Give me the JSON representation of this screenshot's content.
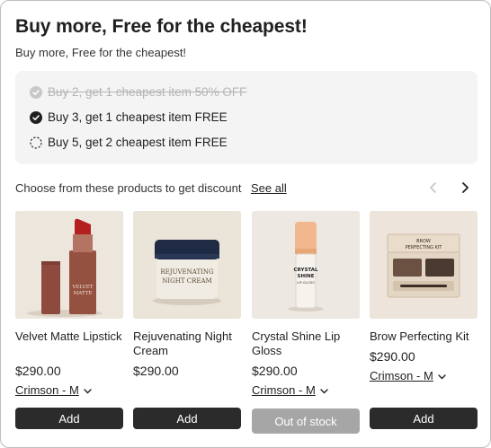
{
  "header": {
    "title": "Buy more, Free for the cheapest!",
    "subtitle": "Buy more, Free for the cheapest!"
  },
  "tiers": [
    {
      "label": "Buy 2, get 1 cheapest item 50% OFF",
      "state": "expired",
      "icon": "check-circle-icon"
    },
    {
      "label": "Buy 3, get 1 cheapest item FREE",
      "state": "achieved",
      "icon": "check-circle-icon"
    },
    {
      "label": "Buy 5, get 2 cheapest item FREE",
      "state": "pending",
      "icon": "dashed-circle-icon"
    }
  ],
  "products_section": {
    "label": "Choose from these products to get discount",
    "see_all": "See all"
  },
  "products": [
    {
      "name": "Velvet Matte Lipstick",
      "price": "$290.00",
      "variant": "Crimson - M",
      "button": "Add",
      "in_stock": true,
      "packaging_text": "VELVET MATTE"
    },
    {
      "name": "Rejuvenating Night Cream",
      "price": "$290.00",
      "variant": "",
      "button": "Add",
      "in_stock": true,
      "packaging_text": "REJUVENATING NIGHT CREAM"
    },
    {
      "name": "Crystal Shine Lip Gloss",
      "price": "$290.00",
      "variant": "Crimson - M",
      "button": "Out of stock",
      "in_stock": false,
      "packaging_text": "CRYSTAL SHINE LIP GLOSS"
    },
    {
      "name": "Brow Perfecting Kit",
      "price": "$290.00",
      "variant": "Crimson - M",
      "button": "Add",
      "in_stock": true,
      "packaging_text": "BROW PERFECTING KIT"
    }
  ],
  "colors": {
    "accent": "#2b2b2b",
    "disabled": "#a6a6a6",
    "panel": "#f4f4f4",
    "product_bg": "#ece5dc"
  }
}
